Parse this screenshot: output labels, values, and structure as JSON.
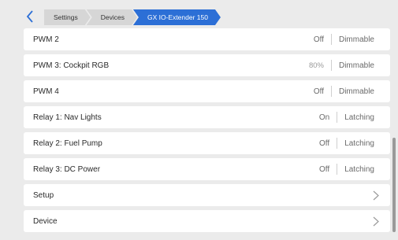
{
  "breadcrumb": {
    "items": [
      "Settings",
      "Devices",
      "GX IO-Extender 150"
    ]
  },
  "rows": [
    {
      "label": "PWM 2",
      "value": "Off",
      "mode": "Dimmable"
    },
    {
      "label": "PWM 3: Cockpit RGB",
      "value": "80%",
      "mode": "Dimmable"
    },
    {
      "label": "PWM 4",
      "value": "Off",
      "mode": "Dimmable"
    },
    {
      "label": "Relay 1: Nav Lights",
      "value": "On",
      "mode": "Latching"
    },
    {
      "label": "Relay 2: Fuel Pump",
      "value": "Off",
      "mode": "Latching"
    },
    {
      "label": "Relay 3: DC Power",
      "value": "Off",
      "mode": "Latching"
    },
    {
      "label": "Setup"
    },
    {
      "label": "Device"
    }
  ],
  "colors": {
    "accent": "#2c6fd6",
    "background": "#ebebeb",
    "row": "#ffffff"
  }
}
